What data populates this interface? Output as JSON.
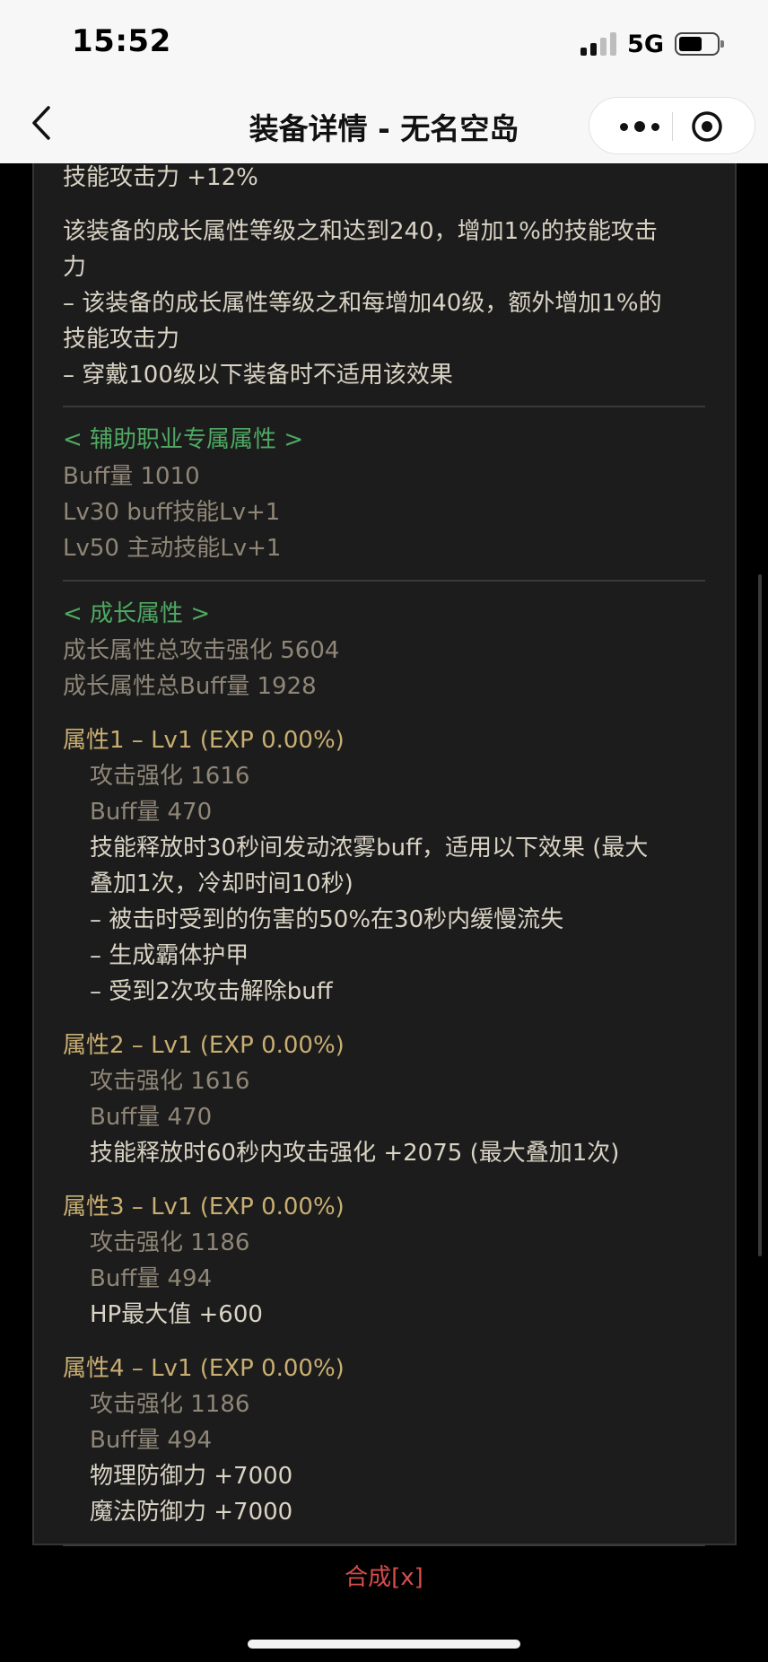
{
  "status": {
    "time": "15:52",
    "network": "5G"
  },
  "nav": {
    "title": "装备详情 - 无名空岛"
  },
  "skill": {
    "line1": "技能攻击力  +12%",
    "desc1": "该装备的成长属性等级之和达到240，增加1%的技能攻击",
    "desc1b": "力",
    "desc2": "– 该装备的成长属性等级之和每增加40级，额外增加1%的",
    "desc2b": "技能攻击力",
    "desc3": "– 穿戴100级以下装备时不适用该效果"
  },
  "support": {
    "heading": "< 辅助职业专属属性 >",
    "buff": "Buff量  1010",
    "lv30": "Lv30 buff技能Lv+1",
    "lv50": "Lv50 主动技能Lv+1"
  },
  "growth": {
    "heading": "< 成长属性 >",
    "total_attack": "成长属性总攻击强化 5604",
    "total_buff": "成长属性总Buff量 1928"
  },
  "attributes": [
    {
      "title": "属性1 – Lv1 (EXP 0.00%)",
      "attack": "攻击强化  1616",
      "buff": "Buff量  470",
      "effects": [
        "技能释放时30秒间发动浓雾buff，适用以下效果 (最大",
        "叠加1次，冷却时间10秒)",
        "– 被击时受到的伤害的50%在30秒内缓慢流失",
        "– 生成霸体护甲",
        "– 受到2次攻击解除buff"
      ]
    },
    {
      "title": "属性2 – Lv1 (EXP 0.00%)",
      "attack": "攻击强化  1616",
      "buff": "Buff量  470",
      "effects": [
        "技能释放时60秒内攻击强化 +2075 (最大叠加1次)"
      ]
    },
    {
      "title": "属性3 – Lv1 (EXP 0.00%)",
      "attack": "攻击强化  1186",
      "buff": "Buff量  494",
      "effects": [
        "HP最大值 +600"
      ]
    },
    {
      "title": "属性4 – Lv1 (EXP 0.00%)",
      "attack": "攻击强化  1186",
      "buff": "Buff量  494",
      "effects": [
        "物理防御力 +7000",
        "魔法防御力 +7000"
      ]
    }
  ],
  "synth": {
    "label": "合成[x]"
  },
  "colors": {
    "light_text": "#d9d3c4",
    "dim_text": "#8f8677",
    "gold_text": "#c9ae72",
    "green_heading": "#4fa862",
    "red_link": "#d84c4c"
  }
}
